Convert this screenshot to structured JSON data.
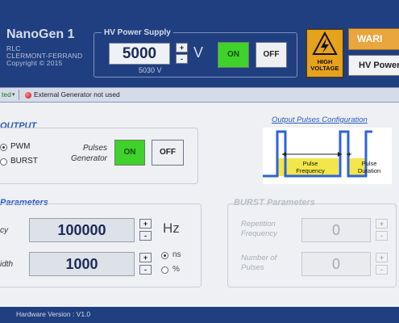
{
  "app": {
    "title": "NanoGen 1",
    "subtitle_lines": [
      "RLC",
      "CLERMONT-FERRAND",
      "Copyright © 2015"
    ]
  },
  "hv_power_supply": {
    "title": "HV Power Supply",
    "value": "5000",
    "unit": "V",
    "readback": "5030 V",
    "on_label": "ON",
    "off_label": "OFF"
  },
  "warnings": {
    "hv_label_line1": "HIGH",
    "hv_label_line2": "VOLTAGE",
    "warning_button": "WARI",
    "hv_power_button": "HV Power"
  },
  "status_strip": {
    "left_text": "ted",
    "external_generator": "External Generator not used"
  },
  "output": {
    "title": "OUTPUT",
    "pwm_label": "PWM",
    "burst_label": "BURST",
    "pulses_generator_line1": "Pulses",
    "pulses_generator_line2": "Generator",
    "on_label": "ON",
    "off_label": "OFF"
  },
  "pulses_config": {
    "link": "Output Pulses Configuration",
    "frequency_line1": "Pulse",
    "frequency_line2": "Frequency",
    "duration_line1": "Pulse",
    "duration_line2": "Duration"
  },
  "pwm_parameters": {
    "title": "Parameters",
    "frequency_label": "cy",
    "frequency_value": "100000",
    "frequency_unit": "Hz",
    "width_label": "idth",
    "width_value": "1000",
    "ns_label": "ns",
    "percent_label": "%"
  },
  "burst_parameters": {
    "title": "BURST Parameters",
    "rep_freq_line1": "Repetition",
    "rep_freq_line2": "Frequency",
    "rep_freq_value": "0",
    "pulses_line1": "Number of",
    "pulses_line2": "Pulses",
    "pulses_value": "0"
  },
  "footer": {
    "hardware_version": "Hardware Version : V1.0"
  },
  "colors": {
    "header_navy": "#203f80",
    "on_green": "#3ed22a",
    "warning_orange": "#e6a21c",
    "accent_blue": "#2f5bc0",
    "pulse_blue": "#2c63d8",
    "pulse_highlight": "#f2e64a"
  }
}
